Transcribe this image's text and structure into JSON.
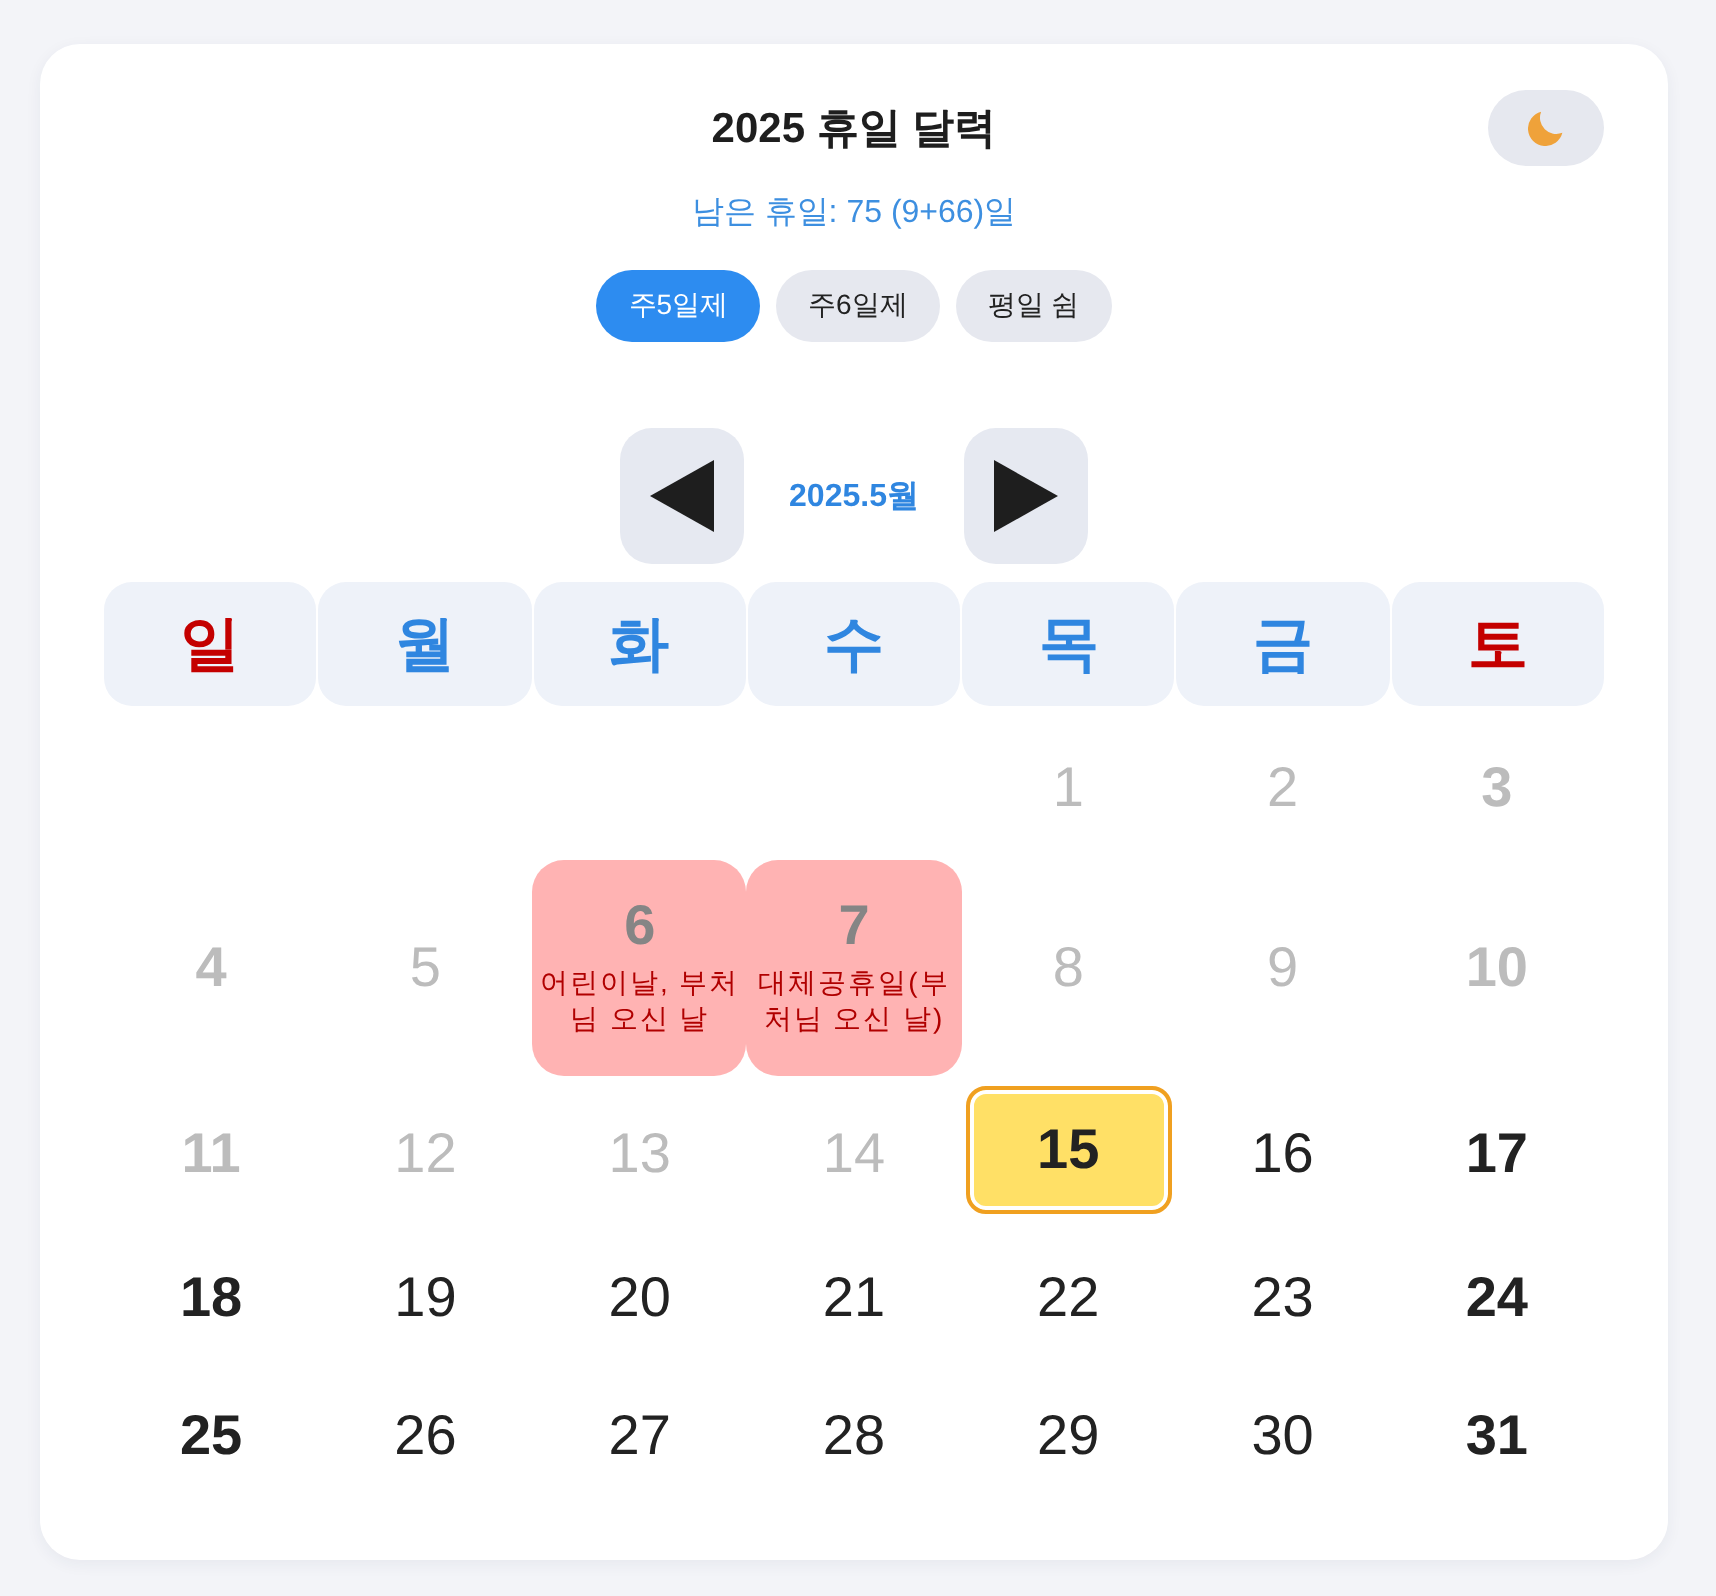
{
  "header": {
    "title": "2025 휴일 달력",
    "remaining": "남은 휴일: 75 (9+66)일"
  },
  "mode_tabs": [
    {
      "label": "주5일제",
      "selected": true
    },
    {
      "label": "주6일제",
      "selected": false
    },
    {
      "label": "평일 쉼",
      "selected": false
    }
  ],
  "calendar": {
    "month_label": "2025.5월",
    "weekdays": [
      {
        "label": "일",
        "weekend": true
      },
      {
        "label": "월",
        "weekend": false
      },
      {
        "label": "화",
        "weekend": false
      },
      {
        "label": "수",
        "weekend": false
      },
      {
        "label": "목",
        "weekend": false
      },
      {
        "label": "금",
        "weekend": false
      },
      {
        "label": "토",
        "weekend": true
      }
    ],
    "weeks": [
      {
        "align_end": true,
        "days": [
          {
            "day": "1",
            "past": true,
            "day_off": false,
            "today": false
          },
          {
            "day": "2",
            "past": true,
            "day_off": false,
            "today": false
          },
          {
            "day": "3",
            "past": true,
            "day_off": true,
            "today": false
          }
        ]
      },
      {
        "days": [
          {
            "day": "4",
            "past": true,
            "day_off": true,
            "today": false
          },
          {
            "day": "5",
            "past": true,
            "day_off": false,
            "today": false
          },
          {
            "day": "6",
            "past": true,
            "day_off": true,
            "today": false,
            "holiday_name": "어린이날, 부처님 오신 날"
          },
          {
            "day": "7",
            "past": true,
            "day_off": true,
            "today": false,
            "holiday_name": "대체공휴일(부처님 오신 날)"
          },
          {
            "day": "8",
            "past": true,
            "day_off": false,
            "today": false
          },
          {
            "day": "9",
            "past": true,
            "day_off": false,
            "today": false
          },
          {
            "day": "10",
            "past": true,
            "day_off": true,
            "today": false
          }
        ]
      },
      {
        "days": [
          {
            "day": "11",
            "past": true,
            "day_off": true,
            "today": false
          },
          {
            "day": "12",
            "past": true,
            "day_off": false,
            "today": false
          },
          {
            "day": "13",
            "past": true,
            "day_off": false,
            "today": false
          },
          {
            "day": "14",
            "past": true,
            "day_off": false,
            "today": false
          },
          {
            "day": "15",
            "past": false,
            "day_off": true,
            "today": true
          },
          {
            "day": "16",
            "past": false,
            "day_off": false,
            "today": false
          },
          {
            "day": "17",
            "past": false,
            "day_off": true,
            "today": false
          }
        ]
      },
      {
        "days": [
          {
            "day": "18",
            "past": false,
            "day_off": true,
            "today": false
          },
          {
            "day": "19",
            "past": false,
            "day_off": false,
            "today": false
          },
          {
            "day": "20",
            "past": false,
            "day_off": false,
            "today": false
          },
          {
            "day": "21",
            "past": false,
            "day_off": false,
            "today": false
          },
          {
            "day": "22",
            "past": false,
            "day_off": false,
            "today": false
          },
          {
            "day": "23",
            "past": false,
            "day_off": false,
            "today": false
          },
          {
            "day": "24",
            "past": false,
            "day_off": true,
            "today": false
          }
        ]
      },
      {
        "days": [
          {
            "day": "25",
            "past": false,
            "day_off": true,
            "today": false
          },
          {
            "day": "26",
            "past": false,
            "day_off": false,
            "today": false
          },
          {
            "day": "27",
            "past": false,
            "day_off": false,
            "today": false
          },
          {
            "day": "28",
            "past": false,
            "day_off": false,
            "today": false
          },
          {
            "day": "29",
            "past": false,
            "day_off": false,
            "today": false
          },
          {
            "day": "30",
            "past": false,
            "day_off": false,
            "today": false
          },
          {
            "day": "31",
            "past": false,
            "day_off": true,
            "today": false
          }
        ]
      }
    ]
  }
}
